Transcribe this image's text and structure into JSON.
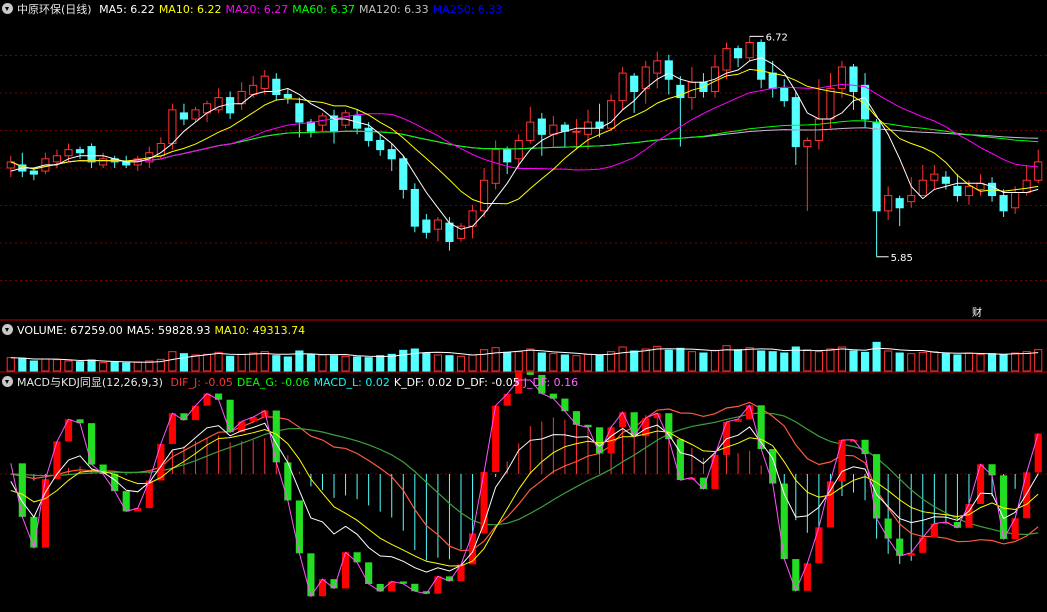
{
  "colors": {
    "up": "#ff3232",
    "down": "#54ffff",
    "grid": "#7a0000",
    "axis": "#c00000",
    "ma5": "#ffffff",
    "ma10": "#ffff00",
    "ma20": "#ff00ff",
    "ma60": "#00ff00",
    "ma120": "#c0c0c0",
    "ma250": "#0000ff"
  },
  "price_panel": {
    "title": "中原环保(日线)",
    "items": [
      {
        "label": "MA5: 6.22",
        "color": "#ffffff"
      },
      {
        "label": "MA10: 6.22",
        "color": "#ffff00"
      },
      {
        "label": "MA20: 6.27",
        "color": "#ff00ff"
      },
      {
        "label": "MA60: 6.37",
        "color": "#00ff00"
      },
      {
        "label": "MA120: 6.33",
        "color": "#c0c0c0"
      },
      {
        "label": "MA250: 6.33",
        "color": "#0000ff"
      }
    ],
    "high_label": "6.72",
    "low_label": "5.85",
    "marker_label": "财"
  },
  "volume_panel": {
    "items": [
      {
        "label": "VOLUME: 67259.00",
        "color": "#ffffff"
      },
      {
        "label": "MA5: 59828.93",
        "color": "#ffffff"
      },
      {
        "label": "MA10: 49313.74",
        "color": "#ffff00"
      }
    ]
  },
  "macd_panel": {
    "title": "MACD与KDJ同显(12,26,9,3)",
    "items": [
      {
        "label": "DIF_J: -0.05",
        "color": "#ff3232"
      },
      {
        "label": "DEA_G: -0.06",
        "color": "#00ff00"
      },
      {
        "label": "MACD_L: 0.02",
        "color": "#00ffff"
      },
      {
        "label": "K_DF: 0.02",
        "color": "#ffffff"
      },
      {
        "label": "D_DF: -0.05",
        "color": "#ffffff"
      },
      {
        "label": "J_DF: 0.16",
        "color": "#ff66ff"
      }
    ]
  },
  "chart_data": {
    "type": "candlestick",
    "note_scale": "price",
    "ylim": [
      5.8,
      6.78
    ],
    "candles": [
      [
        6.29,
        6.31,
        6.26,
        6.33
      ],
      [
        6.3,
        6.28,
        6.26,
        6.34
      ],
      [
        6.28,
        6.27,
        6.25,
        6.29
      ],
      [
        6.28,
        6.32,
        6.27,
        6.34
      ],
      [
        6.31,
        6.33,
        6.29,
        6.35
      ],
      [
        6.33,
        6.35,
        6.31,
        6.37
      ],
      [
        6.35,
        6.34,
        6.32,
        6.36
      ],
      [
        6.36,
        6.31,
        6.29,
        6.37
      ],
      [
        6.3,
        6.32,
        6.29,
        6.34
      ],
      [
        6.32,
        6.31,
        6.29,
        6.33
      ],
      [
        6.31,
        6.3,
        6.29,
        6.33
      ],
      [
        6.3,
        6.32,
        6.28,
        6.33
      ],
      [
        6.31,
        6.34,
        6.29,
        6.36
      ],
      [
        6.33,
        6.37,
        6.32,
        6.39
      ],
      [
        6.37,
        6.48,
        6.35,
        6.5
      ],
      [
        6.47,
        6.45,
        6.43,
        6.5
      ],
      [
        6.45,
        6.48,
        6.44,
        6.49
      ],
      [
        6.47,
        6.5,
        6.44,
        6.51
      ],
      [
        6.48,
        6.52,
        6.47,
        6.55
      ],
      [
        6.52,
        6.47,
        6.45,
        6.54
      ],
      [
        6.5,
        6.54,
        6.48,
        6.57
      ],
      [
        6.53,
        6.56,
        6.52,
        6.59
      ],
      [
        6.55,
        6.59,
        6.53,
        6.61
      ],
      [
        6.58,
        6.53,
        6.51,
        6.6
      ],
      [
        6.53,
        6.52,
        6.5,
        6.55
      ],
      [
        6.5,
        6.44,
        6.39,
        6.52
      ],
      [
        6.44,
        6.41,
        6.39,
        6.45
      ],
      [
        6.43,
        6.46,
        6.41,
        6.47
      ],
      [
        6.46,
        6.41,
        6.37,
        6.48
      ],
      [
        6.43,
        6.47,
        6.42,
        6.48
      ],
      [
        6.46,
        6.42,
        6.4,
        6.48
      ],
      [
        6.42,
        6.38,
        6.36,
        6.44
      ],
      [
        6.38,
        6.35,
        6.33,
        6.4
      ],
      [
        6.35,
        6.32,
        6.28,
        6.37
      ],
      [
        6.32,
        6.22,
        6.19,
        6.33
      ],
      [
        6.22,
        6.1,
        6.08,
        6.24
      ],
      [
        6.12,
        6.08,
        6.06,
        6.14
      ],
      [
        6.09,
        6.12,
        6.05,
        6.13
      ],
      [
        6.11,
        6.05,
        6.02,
        6.13
      ],
      [
        6.06,
        6.1,
        6.05,
        6.11
      ],
      [
        6.1,
        6.15,
        6.06,
        6.17
      ],
      [
        6.15,
        6.25,
        6.13,
        6.29
      ],
      [
        6.24,
        6.35,
        6.22,
        6.38
      ],
      [
        6.35,
        6.31,
        6.27,
        6.36
      ],
      [
        6.32,
        6.38,
        6.29,
        6.4
      ],
      [
        6.38,
        6.44,
        6.37,
        6.49
      ],
      [
        6.45,
        6.4,
        6.33,
        6.47
      ],
      [
        6.4,
        6.43,
        6.36,
        6.46
      ],
      [
        6.43,
        6.41,
        6.36,
        6.44
      ],
      [
        6.41,
        6.41,
        6.35,
        6.45
      ],
      [
        6.4,
        6.44,
        6.35,
        6.48
      ],
      [
        6.44,
        6.42,
        6.39,
        6.5
      ],
      [
        6.42,
        6.51,
        6.41,
        6.53
      ],
      [
        6.51,
        6.6,
        6.48,
        6.62
      ],
      [
        6.59,
        6.54,
        6.47,
        6.6
      ],
      [
        6.55,
        6.62,
        6.5,
        6.64
      ],
      [
        6.6,
        6.64,
        6.55,
        6.67
      ],
      [
        6.64,
        6.58,
        6.53,
        6.66
      ],
      [
        6.56,
        6.52,
        6.36,
        6.59
      ],
      [
        6.52,
        6.57,
        6.48,
        6.62
      ],
      [
        6.57,
        6.54,
        6.52,
        6.6
      ],
      [
        6.54,
        6.62,
        6.52,
        6.66
      ],
      [
        6.61,
        6.68,
        6.58,
        6.7
      ],
      [
        6.68,
        6.65,
        6.62,
        6.69
      ],
      [
        6.65,
        6.7,
        6.64,
        6.72
      ],
      [
        6.7,
        6.58,
        6.55,
        6.71
      ],
      [
        6.6,
        6.55,
        6.52,
        6.64
      ],
      [
        6.55,
        6.51,
        6.49,
        6.58
      ],
      [
        6.52,
        6.36,
        6.3,
        6.54
      ],
      [
        6.36,
        6.38,
        6.15,
        6.39
      ],
      [
        6.38,
        6.45,
        6.35,
        6.58
      ],
      [
        6.45,
        6.55,
        6.42,
        6.6
      ],
      [
        6.55,
        6.62,
        6.52,
        6.64
      ],
      [
        6.62,
        6.54,
        6.48,
        6.63
      ],
      [
        6.56,
        6.45,
        6.42,
        6.6
      ],
      [
        6.44,
        6.15,
        6.0,
        6.45
      ],
      [
        6.15,
        6.2,
        6.12,
        6.23
      ],
      [
        6.19,
        6.16,
        6.1,
        6.2
      ],
      [
        6.18,
        6.2,
        6.16,
        6.26
      ],
      [
        6.2,
        6.25,
        6.2,
        6.3
      ],
      [
        6.25,
        6.27,
        6.22,
        6.3
      ],
      [
        6.26,
        6.24,
        6.22,
        6.28
      ],
      [
        6.23,
        6.2,
        6.18,
        6.27
      ],
      [
        6.2,
        6.23,
        6.17,
        6.25
      ],
      [
        6.22,
        6.24,
        6.2,
        6.27
      ],
      [
        6.24,
        6.2,
        6.18,
        6.26
      ],
      [
        6.2,
        6.15,
        6.13,
        6.22
      ],
      [
        6.16,
        6.21,
        6.14,
        6.23
      ],
      [
        6.21,
        6.25,
        6.2,
        6.3
      ],
      [
        6.25,
        6.31,
        6.24,
        6.35
      ]
    ],
    "volume": [
      40,
      38,
      30,
      36,
      34,
      30,
      28,
      33,
      25,
      26,
      24,
      26,
      30,
      35,
      58,
      52,
      48,
      50,
      56,
      44,
      50,
      54,
      58,
      46,
      42,
      60,
      50,
      48,
      46,
      44,
      42,
      40,
      46,
      50,
      62,
      66,
      54,
      48,
      46,
      44,
      48,
      64,
      70,
      56,
      58,
      66,
      54,
      52,
      48,
      46,
      50,
      48,
      58,
      72,
      60,
      66,
      74,
      62,
      68,
      58,
      54,
      62,
      76,
      64,
      70,
      60,
      58,
      54,
      72,
      64,
      58,
      66,
      72,
      60,
      56,
      86,
      60,
      54,
      52,
      56,
      58,
      52,
      48,
      54,
      50,
      52,
      48,
      54,
      58,
      64
    ],
    "ma_series": {
      "ma5": [
        6.28,
        6.29,
        6.29,
        6.3,
        6.3,
        6.32,
        6.33,
        6.33,
        6.33,
        6.32,
        6.31,
        6.31,
        6.32,
        6.34,
        6.37,
        6.41,
        6.44,
        6.47,
        6.49,
        6.5,
        6.5,
        6.53,
        6.54,
        6.54,
        6.55,
        6.53,
        6.5,
        6.48,
        6.45,
        6.45,
        6.44,
        6.43,
        6.4,
        6.37,
        6.33,
        6.27,
        6.21,
        6.16,
        6.11,
        6.09,
        6.1,
        6.14,
        6.19,
        6.24,
        6.3,
        6.35,
        6.38,
        6.4,
        6.41,
        6.42,
        6.42,
        6.42,
        6.44,
        6.48,
        6.51,
        6.55,
        6.58,
        6.6,
        6.58,
        6.57,
        6.57,
        6.58,
        6.6,
        6.61,
        6.64,
        6.65,
        6.63,
        6.6,
        6.54,
        6.47,
        6.45,
        6.45,
        6.47,
        6.51,
        6.52,
        6.46,
        6.4,
        6.32,
        6.23,
        6.19,
        6.22,
        6.23,
        6.24,
        6.24,
        6.24,
        6.23,
        6.21,
        6.21,
        6.21,
        6.22
      ]
    }
  }
}
